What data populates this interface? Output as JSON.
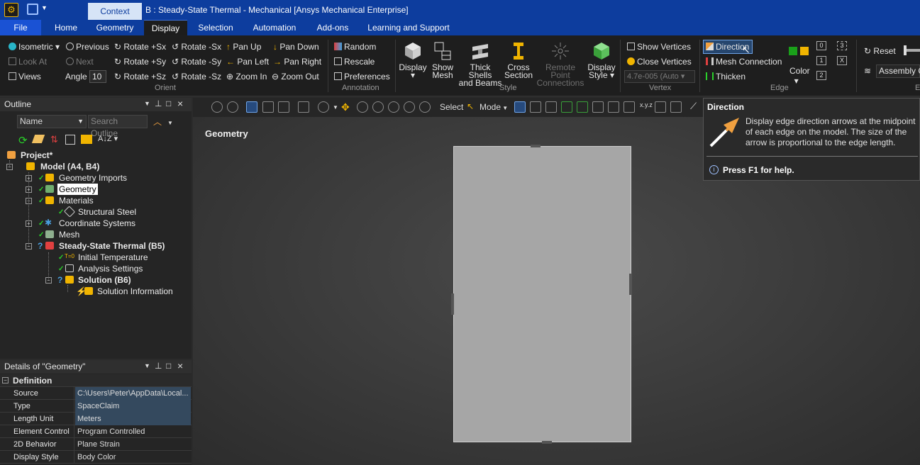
{
  "window": {
    "title": "B : Steady-State Thermal - Mechanical [Ansys Mechanical Enterprise]",
    "context_tab": "Context"
  },
  "menu_tabs": [
    "File",
    "Home",
    "Geometry",
    "Display",
    "Selection",
    "Automation",
    "Add-ons",
    "Learning and Support"
  ],
  "ribbon": {
    "orient": {
      "group_label": "Orient",
      "isometric": "Isometric",
      "look_at": "Look At",
      "views": "Views",
      "previous": "Previous",
      "next": "Next",
      "angle_label": "Angle",
      "angle_value": "10",
      "rotate_px": "Rotate +Sx",
      "rotate_mx": "Rotate -Sx",
      "rotate_py": "Rotate +Sy",
      "rotate_my": "Rotate -Sy",
      "rotate_pz": "Rotate +Sz",
      "rotate_mz": "Rotate -Sz",
      "pan_up": "Pan Up",
      "pan_down": "Pan Down",
      "pan_left": "Pan Left",
      "pan_right": "Pan Right",
      "zoom_in": "Zoom In",
      "zoom_out": "Zoom Out"
    },
    "annotation": {
      "group_label": "Annotation",
      "random": "Random",
      "rescale": "Rescale",
      "preferences": "Preferences"
    },
    "style": {
      "group_label": "Style",
      "display": "Display",
      "show_mesh": [
        "Show",
        "Mesh"
      ],
      "thick_shells": [
        "Thick Shells",
        "and Beams"
      ],
      "cross_section": [
        "Cross",
        "Section"
      ],
      "remote_point": [
        "Remote Point",
        "Connections"
      ],
      "display_style": [
        "Display",
        "Style"
      ]
    },
    "vertex": {
      "group_label": "Vertex",
      "show_vertices": "Show Vertices",
      "close_vertices": "Close Vertices",
      "tolerance": "4.7e-005 (Auto"
    },
    "edge": {
      "group_label": "Edge",
      "direction": "Direction",
      "mesh_connection": "Mesh Connection",
      "thicken": "Thicken",
      "color": "Color",
      "num0": "0",
      "num1": "1",
      "num2": "2",
      "num3": "3",
      "numx": "X"
    },
    "explode": {
      "reset": "Reset",
      "assembly": "Assembly C",
      "group_label": "E"
    }
  },
  "outline": {
    "title": "Outline",
    "name_filter": "Name",
    "search_placeholder": "Search Outline",
    "tree": [
      {
        "label": "Project*"
      },
      {
        "label": "Model (A4, B4)"
      },
      {
        "label": "Geometry Imports"
      },
      {
        "label": "Geometry"
      },
      {
        "label": "Materials"
      },
      {
        "label": "Structural Steel"
      },
      {
        "label": "Coordinate Systems"
      },
      {
        "label": "Mesh"
      },
      {
        "label": "Steady-State Thermal (B5)"
      },
      {
        "label": "Initial Temperature"
      },
      {
        "label": "Analysis Settings"
      },
      {
        "label": "Solution (B6)"
      },
      {
        "label": "Solution Information"
      }
    ]
  },
  "details": {
    "title": "Details of \"Geometry\"",
    "section": "Definition",
    "rows": [
      {
        "key": "Source",
        "value": "C:\\Users\\Peter\\AppData\\Local..."
      },
      {
        "key": "Type",
        "value": "SpaceClaim"
      },
      {
        "key": "Length Unit",
        "value": "Meters"
      },
      {
        "key": "Element Control",
        "value": "Program Controlled"
      },
      {
        "key": "2D Behavior",
        "value": "Plane Strain"
      },
      {
        "key": "Display Style",
        "value": "Body Color"
      }
    ]
  },
  "viewport": {
    "label": "Geometry",
    "select": "Select",
    "mode": "Mode"
  },
  "tooltip": {
    "title": "Direction",
    "text": "Display edge direction arrows at the midpoint of each edge on the model. The size of the arrow is proportional to the edge length.",
    "help": "Press F1 for help."
  },
  "colors": {
    "title_bar": "#0d3d9e",
    "file_tab": "#1a52d4",
    "check_green": "#2ad02a",
    "edge_green": "#1aa01a",
    "edge_yellow": "#f0b400",
    "tooltip_arrow": "#f0a040"
  }
}
